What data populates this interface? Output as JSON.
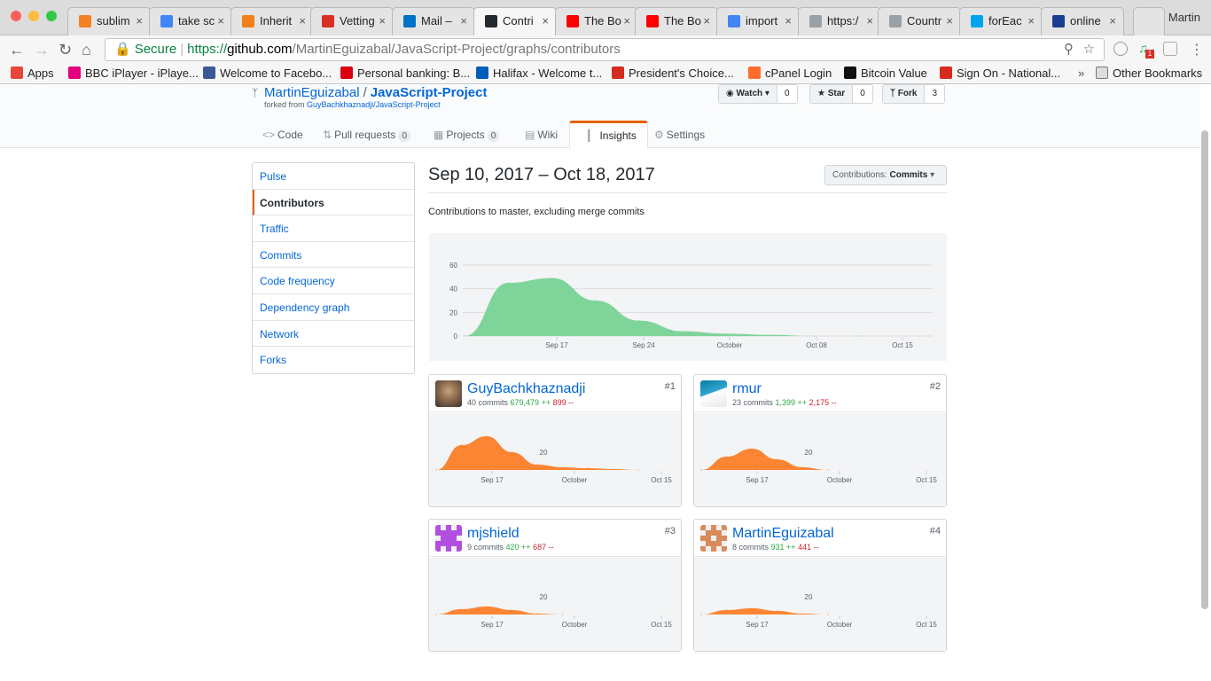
{
  "browser": {
    "tabs": [
      {
        "label": "sublim",
        "icon": "stackoverflow-icon",
        "color": "#f48024"
      },
      {
        "label": "take sc",
        "icon": "google-icon",
        "color": "#4285f4"
      },
      {
        "label": "Inherit",
        "icon": "orange-square-icon",
        "color": "#f0801a"
      },
      {
        "label": "Vetting",
        "icon": "gmail-icon",
        "color": "#d93025"
      },
      {
        "label": "Mail –",
        "icon": "outlook-icon",
        "color": "#0072c6"
      },
      {
        "label": "Contri",
        "icon": "github-icon",
        "color": "#24292e"
      },
      {
        "label": "The Bo",
        "icon": "youtube-icon",
        "color": "#ff0000"
      },
      {
        "label": "The Bo",
        "icon": "youtube-icon",
        "color": "#ff0000"
      },
      {
        "label": "import",
        "icon": "google-icon",
        "color": "#4285f4"
      },
      {
        "label": "https:/",
        "icon": "document-icon",
        "color": "#9aa0a6"
      },
      {
        "label": "Countr",
        "icon": "document-icon",
        "color": "#9aa0a6"
      },
      {
        "label": "forEac",
        "icon": "microsoft-icon",
        "color": "#00a4ef"
      },
      {
        "label": "online",
        "icon": "site-icon",
        "color": "#1a3d8f"
      }
    ],
    "profile": "Martin",
    "url": {
      "secure_label": "Secure",
      "scheme": "https://",
      "host": "github.com",
      "path": "/MartinEguizabal/JavaScript-Project/graphs/contributors"
    },
    "bookmarks": [
      {
        "label": "Apps",
        "icon": "apps-grid-icon",
        "color": "#e8453c"
      },
      {
        "label": "BBC iPlayer - iPlaye...",
        "icon": "iplayer-icon",
        "color": "#e4007c"
      },
      {
        "label": "Welcome to Facebo...",
        "icon": "facebook-icon",
        "color": "#3b5998"
      },
      {
        "label": "Personal banking: B...",
        "icon": "hsbc-icon",
        "color": "#db0011"
      },
      {
        "label": "Halifax - Welcome t...",
        "icon": "halifax-icon",
        "color": "#005eb8"
      },
      {
        "label": "President's Choice...",
        "icon": "canada-flag-icon",
        "color": "#d52b1e"
      },
      {
        "label": "cPanel Login",
        "icon": "cpanel-icon",
        "color": "#ff6c2c"
      },
      {
        "label": "Bitcoin Value",
        "icon": "bitcoin-icon",
        "color": "#111111"
      },
      {
        "label": "Sign On - National...",
        "icon": "maple-leaf-icon",
        "color": "#d52b1e"
      }
    ],
    "bookmarks_overflow": "»",
    "other_bookmarks": "Other Bookmarks"
  },
  "repo": {
    "owner": "MartinEguizabal",
    "name": "JavaScript-Project",
    "forked_prefix": "forked from",
    "forked_from": "GuyBachkhaznadji/JavaScript-Project",
    "watch_label": "Watch",
    "watch_count": "0",
    "star_label": "Star",
    "star_count": "0",
    "fork_label": "Fork",
    "fork_count": "3"
  },
  "reponav": [
    {
      "label": "Code",
      "icon": "code-icon",
      "counter": ""
    },
    {
      "label": "Pull requests",
      "icon": "pull-request-icon",
      "counter": "0"
    },
    {
      "label": "Projects",
      "icon": "project-icon",
      "counter": "0"
    },
    {
      "label": "Wiki",
      "icon": "book-icon",
      "counter": ""
    },
    {
      "label": "Insights",
      "icon": "graph-icon",
      "counter": "",
      "selected": true
    },
    {
      "label": "Settings",
      "icon": "gear-icon",
      "counter": ""
    }
  ],
  "sidebar": [
    {
      "label": "Pulse"
    },
    {
      "label": "Contributors",
      "selected": true
    },
    {
      "label": "Traffic"
    },
    {
      "label": "Commits"
    },
    {
      "label": "Code frequency"
    },
    {
      "label": "Dependency graph"
    },
    {
      "label": "Network"
    },
    {
      "label": "Forks"
    }
  ],
  "main": {
    "date_range": "Sep 10, 2017 – Oct 18, 2017",
    "contrib_select_prefix": "Contributions:",
    "contrib_select_value": "Commits",
    "subtitle": "Contributions to master, excluding merge commits"
  },
  "colors": {
    "accent": "#e36209",
    "link": "#0366d6",
    "main_area": "#7fd49a",
    "contrib_area": "#fb8532",
    "added": "#28a745",
    "deleted": "#cb2431"
  },
  "chart_data": [
    {
      "type": "area",
      "x": [
        "Sep 10",
        "Sep 14",
        "Sep 17",
        "Sep 21",
        "Sep 24",
        "Sep 28",
        "Oct 1",
        "Oct 5",
        "Oct 8",
        "Oct 12"
      ],
      "series": [
        {
          "values": [
            0,
            45,
            49,
            30,
            13,
            4,
            2,
            1,
            0,
            0
          ]
        }
      ],
      "x_ticks": [
        "Sep 17",
        "Sep 24",
        "October",
        "Oct 08",
        "Oct 15"
      ],
      "y_ticks": [
        "0",
        "20",
        "40",
        "60"
      ],
      "ylim": [
        0,
        60
      ],
      "grid": true
    },
    {
      "type": "area",
      "x": [
        "Sep 10",
        "Sep 14",
        "Sep 17",
        "Sep 21",
        "Sep 24",
        "Sep 28",
        "Oct 1",
        "Oct 5",
        "Oct 8"
      ],
      "series": [
        {
          "values": [
            0,
            28,
            38,
            20,
            6,
            3,
            2,
            1,
            0
          ]
        }
      ],
      "x_ticks": [
        "Sep 17",
        "October",
        "Oct 15"
      ],
      "y_ticks": [
        "20"
      ],
      "ylim": [
        0,
        60
      ]
    },
    {
      "type": "area",
      "x": [
        "Sep 10",
        "Sep 14",
        "Sep 17",
        "Sep 21",
        "Sep 24",
        "Sep 28"
      ],
      "series": [
        {
          "values": [
            0,
            15,
            24,
            12,
            3,
            0
          ]
        }
      ],
      "x_ticks": [
        "Sep 17",
        "October",
        "Oct 15"
      ],
      "y_ticks": [
        "20"
      ],
      "ylim": [
        0,
        60
      ]
    },
    {
      "type": "area",
      "x": [
        "Sep 10",
        "Sep 14",
        "Sep 17",
        "Sep 21",
        "Sep 24",
        "Sep 28"
      ],
      "series": [
        {
          "values": [
            0,
            6,
            9,
            5,
            1,
            0
          ]
        }
      ],
      "x_ticks": [
        "Sep 17",
        "October",
        "Oct 15"
      ],
      "y_ticks": [
        "20"
      ],
      "ylim": [
        0,
        60
      ]
    },
    {
      "type": "area",
      "x": [
        "Sep 10",
        "Sep 14",
        "Sep 17",
        "Sep 21",
        "Sep 24",
        "Sep 28"
      ],
      "series": [
        {
          "values": [
            0,
            5,
            7,
            4,
            1,
            0
          ]
        }
      ],
      "x_ticks": [
        "Sep 17",
        "October",
        "Oct 15"
      ],
      "y_ticks": [
        "20"
      ],
      "ylim": [
        0,
        60
      ]
    }
  ],
  "contributors": [
    {
      "name": "GuyBachkhaznadji",
      "rank": "#1",
      "commits": "40 commits",
      "additions": "679,479 ++",
      "deletions": "899 --",
      "avatar": "photo-avatar"
    },
    {
      "name": "rmur",
      "rank": "#2",
      "commits": "23 commits",
      "additions": "1,399 ++",
      "deletions": "2,175 --",
      "avatar": "photo-avatar"
    },
    {
      "name": "mjshield",
      "rank": "#3",
      "commits": "9 commits",
      "additions": "420 ++",
      "deletions": "687 --",
      "avatar": "identicon-purple"
    },
    {
      "name": "MartinEguizabal",
      "rank": "#4",
      "commits": "8 commits",
      "additions": "931 ++",
      "deletions": "441 --",
      "avatar": "identicon-tan"
    }
  ]
}
